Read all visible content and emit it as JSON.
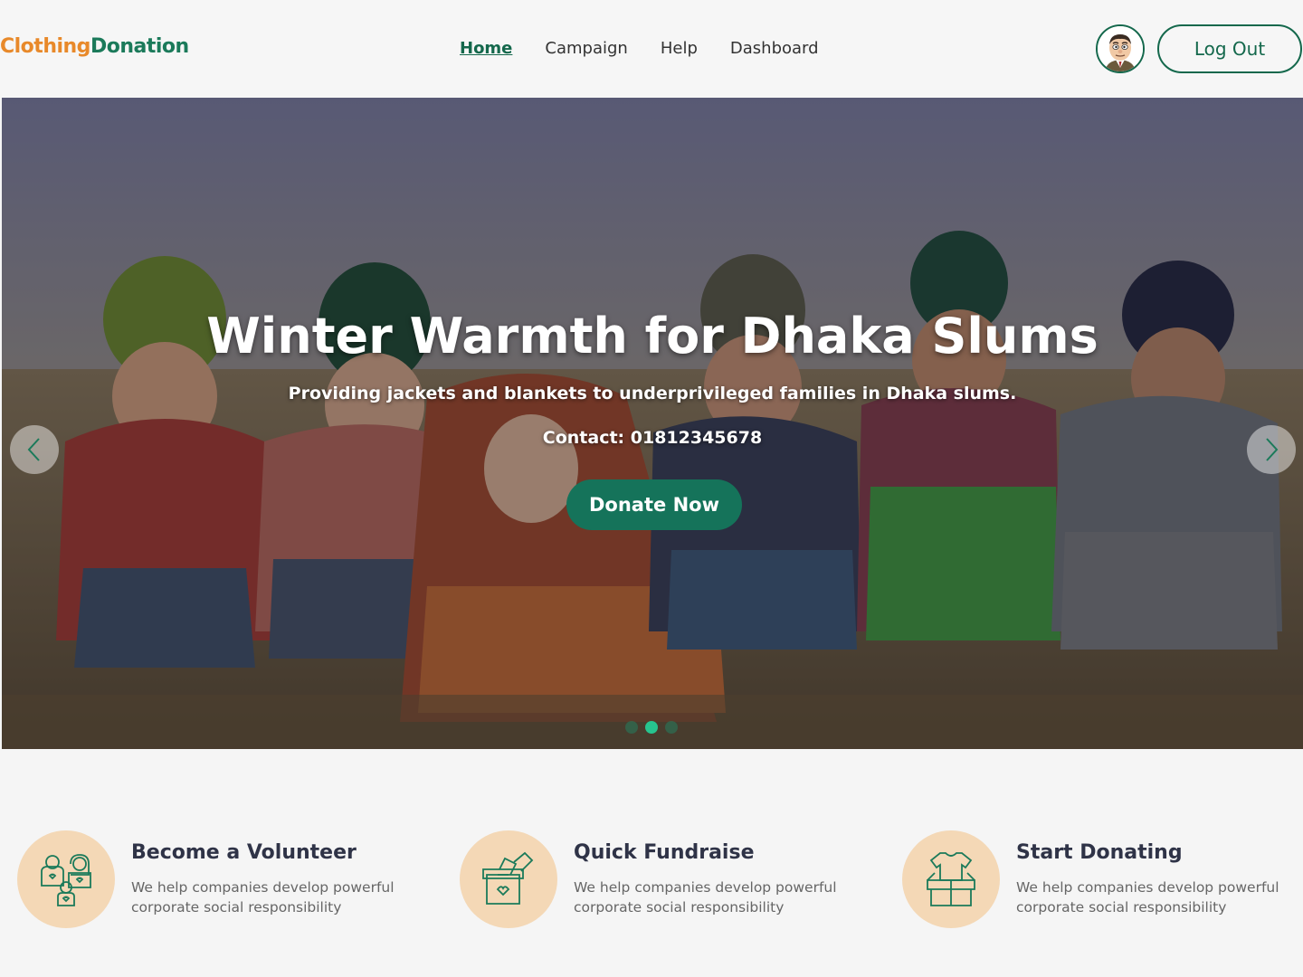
{
  "brand": {
    "part1": "Clothing",
    "part2": "Donation"
  },
  "nav": {
    "items": [
      {
        "label": "Home",
        "active": true
      },
      {
        "label": "Campaign",
        "active": false
      },
      {
        "label": "Help",
        "active": false
      },
      {
        "label": "Dashboard",
        "active": false
      }
    ]
  },
  "account": {
    "avatar_icon": "user-avatar-icon",
    "logout_label": "Log Out"
  },
  "hero": {
    "title": "Winter Warmth for Dhaka Slums",
    "subtitle": "Providing jackets and blankets to underprivileged families in Dhaka slums.",
    "contact": "Contact: 01812345678",
    "cta_label": "Donate Now",
    "slides_total": 3,
    "active_slide": 2,
    "prev_icon": "chevron-left-icon",
    "next_icon": "chevron-right-icon"
  },
  "features": [
    {
      "title": "Become a Volunteer",
      "description": "We help companies develop powerful corporate social responsibility",
      "icon": "volunteers-icon"
    },
    {
      "title": "Quick Fundraise",
      "description": "We help companies develop powerful corporate social responsibility",
      "icon": "donation-box-icon"
    },
    {
      "title": "Start Donating",
      "description": "We help companies develop powerful corporate social responsibility",
      "icon": "clothes-box-icon"
    }
  ],
  "colors": {
    "brand_orange": "#e8892a",
    "brand_green": "#1b7a5a",
    "accent_green": "#15735a",
    "feature_circle": "#f4d8b6"
  }
}
